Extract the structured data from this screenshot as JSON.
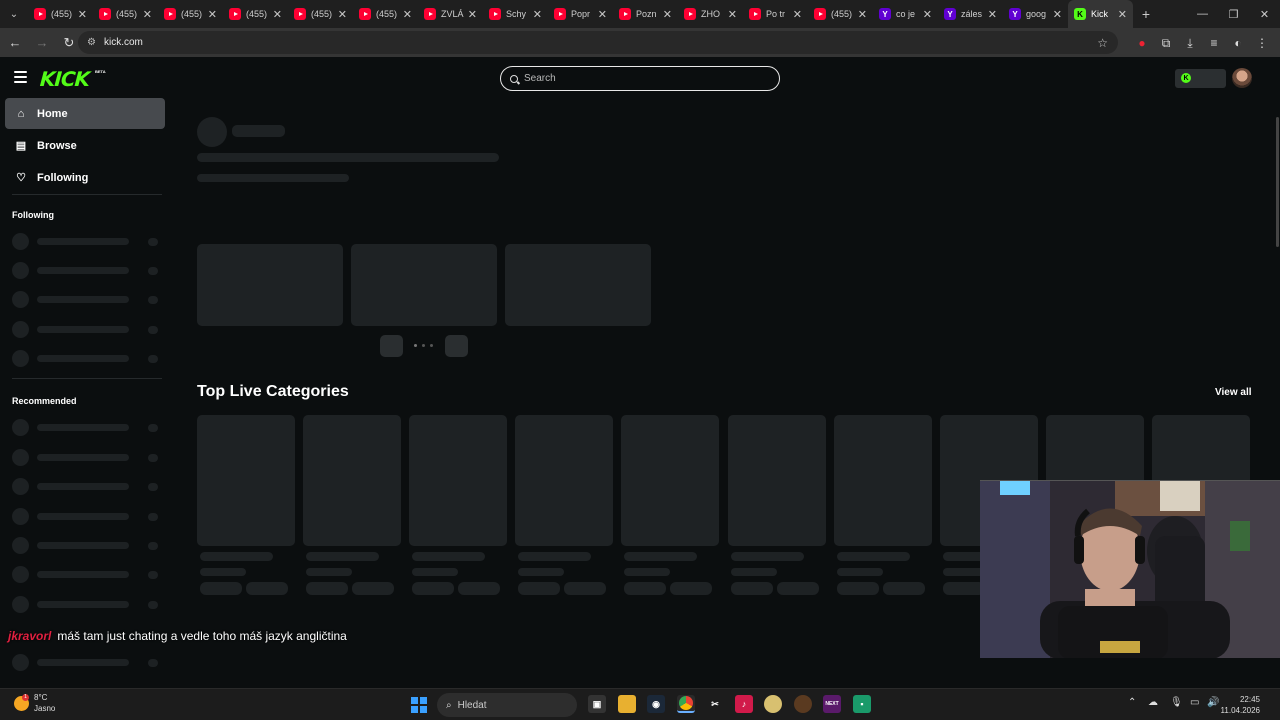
{
  "browser": {
    "tabs": [
      {
        "title": "(455)",
        "type": "yt"
      },
      {
        "title": "(455)",
        "type": "yt"
      },
      {
        "title": "(455)",
        "type": "yt"
      },
      {
        "title": "(455)",
        "type": "yt"
      },
      {
        "title": "(455)",
        "type": "yt"
      },
      {
        "title": "(455)",
        "type": "yt"
      },
      {
        "title": "ZVLÁ",
        "type": "yt"
      },
      {
        "title": "Schy",
        "type": "yt"
      },
      {
        "title": "Popr",
        "type": "yt"
      },
      {
        "title": "Pozn",
        "type": "yt"
      },
      {
        "title": "ZHO",
        "type": "yt"
      },
      {
        "title": "Po tr",
        "type": "yt"
      },
      {
        "title": "(455)",
        "type": "yt"
      },
      {
        "title": "co je",
        "type": "yahoo"
      },
      {
        "title": "záles",
        "type": "yahoo"
      },
      {
        "title": "goog",
        "type": "yahoo"
      },
      {
        "title": "Kick",
        "type": "kick",
        "active": true
      }
    ],
    "url": "kick.com"
  },
  "kick": {
    "logo": "KICK",
    "beta": "BETA",
    "search_placeholder": "Search",
    "nav": [
      {
        "label": "Home",
        "icon": "home-icon",
        "active": true
      },
      {
        "label": "Browse",
        "icon": "browse-icon"
      },
      {
        "label": "Following",
        "icon": "heart-icon"
      }
    ],
    "following_title": "Following",
    "recommended_title": "Recommended",
    "top_live_categories": "Top Live Categories",
    "view_all": "View all"
  },
  "chat_overlay": {
    "user": "jkravorl",
    "message": "máš tam just chating a vedle toho máš jazyk angličtina"
  },
  "taskbar": {
    "weather_temp": "8°C",
    "weather_desc": "Jasno",
    "search_placeholder": "Hledat",
    "time": "22:45",
    "date": "11.04.2026"
  },
  "colors": {
    "kick_green": "#53fc18",
    "page_bg": "#0b0e0f",
    "skeleton": "#1e2224"
  }
}
